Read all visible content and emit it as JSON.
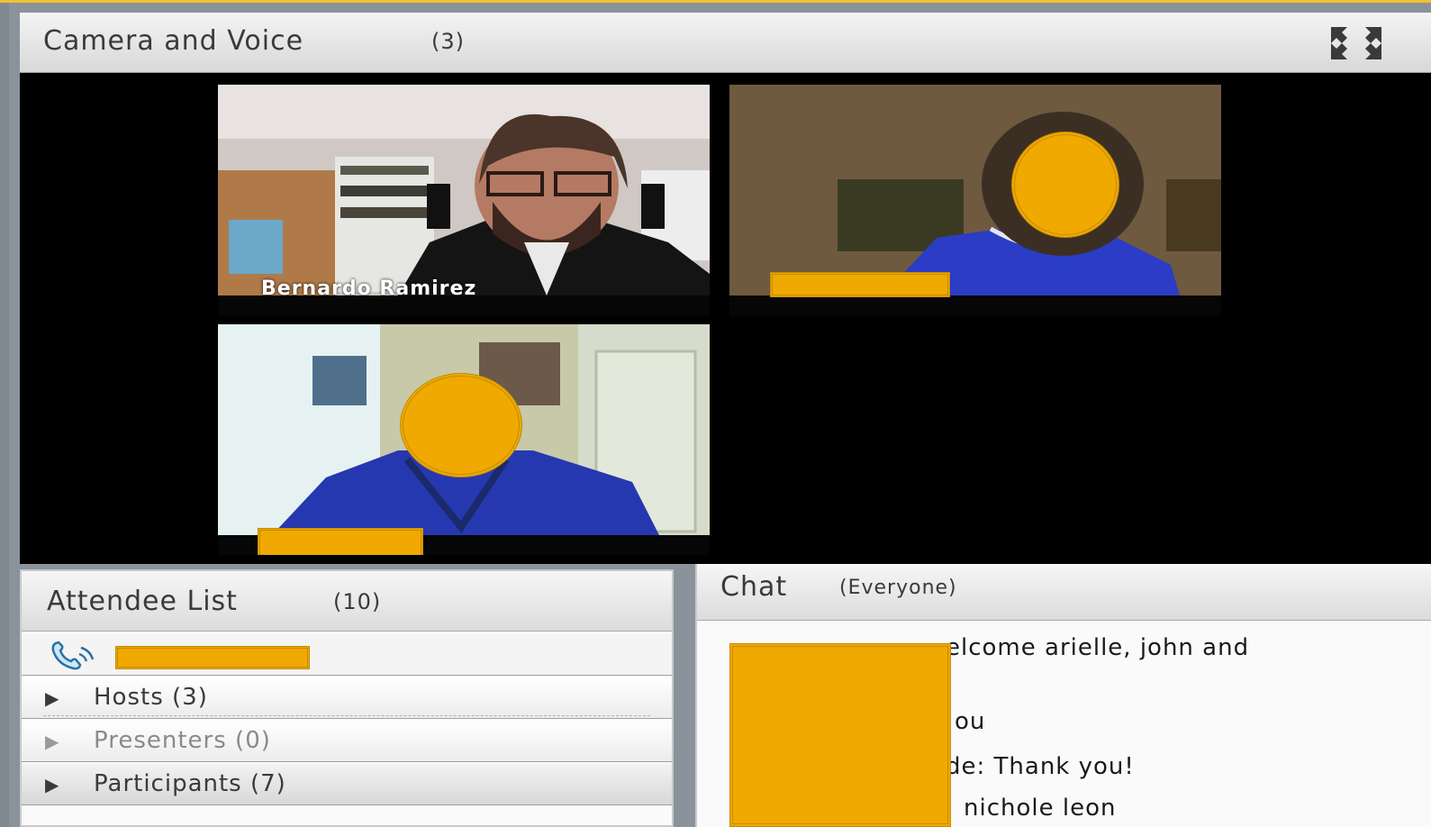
{
  "camera_panel": {
    "title": "Camera and Voice",
    "count": "(3)",
    "fullscreen_icon": "expand-icon",
    "videos": [
      {
        "name": "Bernardo Ramirez"
      },
      {
        "name": ""
      },
      {
        "name": ""
      }
    ]
  },
  "attendee_panel": {
    "title": "Attendee List",
    "count": "(10)",
    "phone_icon": "phone-icon",
    "groups": [
      {
        "label": "Hosts (3)"
      },
      {
        "label": "Presenters (0)"
      },
      {
        "label": "Participants (7)"
      }
    ]
  },
  "chat_panel": {
    "title": "Chat",
    "scope": "(Everyone)",
    "messages": [
      {
        "text": "elcome arielle, john and"
      },
      {
        "text": "ou"
      },
      {
        "text": "de: Thank you!"
      },
      {
        "text": "nichole leon"
      }
    ]
  },
  "colors": {
    "redaction": "#f0a900",
    "panel_header": "#e4e4e4",
    "video_bg": "#000000"
  }
}
